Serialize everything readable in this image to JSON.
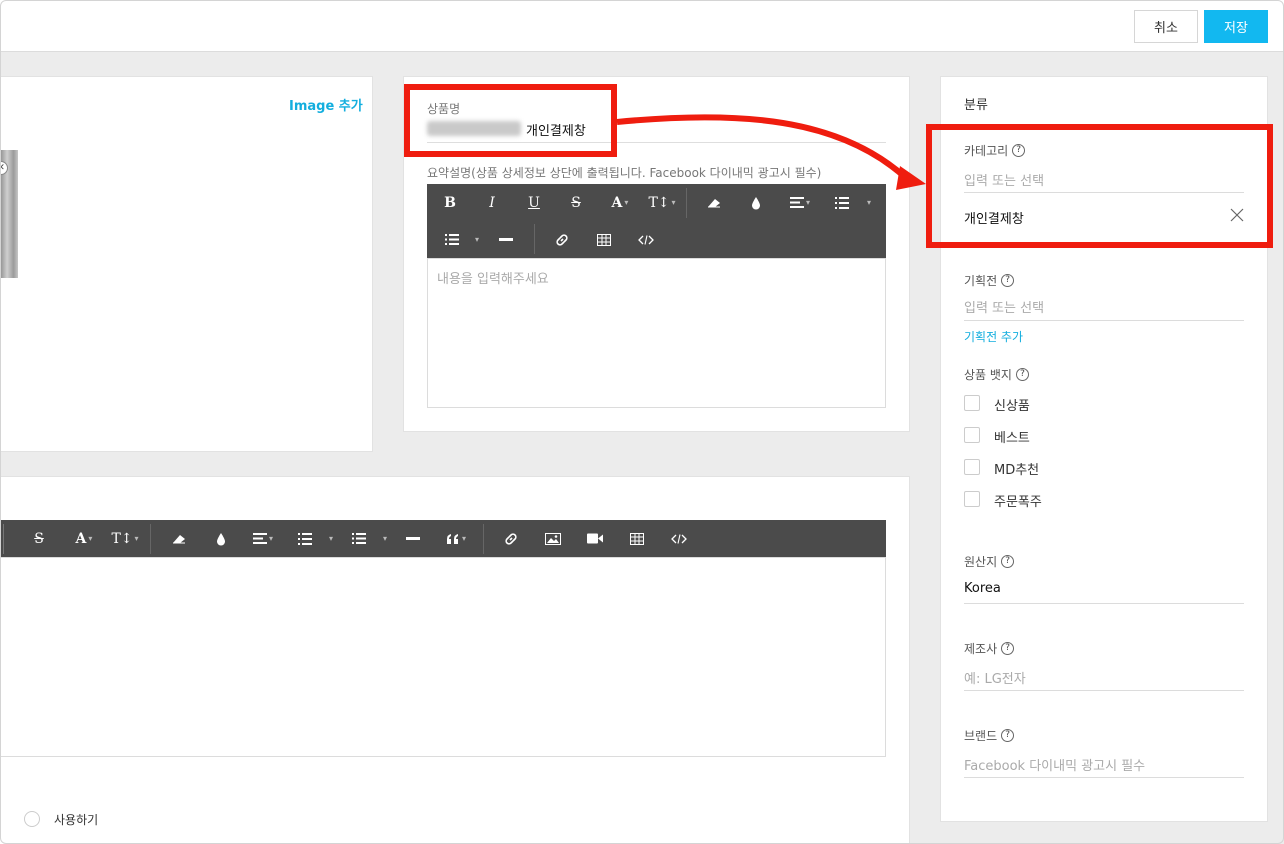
{
  "toolbar": {
    "cancel_label": "취소",
    "save_label": "저장"
  },
  "image_panel": {
    "add_label": "Image 추가",
    "thumb_close": "✕"
  },
  "product": {
    "name_label": "상품명",
    "name_value": "개인결제창",
    "summary_label": "요약설명(상품 상세정보 상단에 출력됩니다. Facebook 다이내믹 광고시 필수)",
    "summary_placeholder": "내용을 입력해주세요"
  },
  "editor_toolbar": {
    "bold": "B",
    "italic": "I",
    "underline": "U",
    "strike": "S",
    "font_color": "A",
    "font_size": "T↕",
    "caret": "▾"
  },
  "description": {
    "use_label": "사용하기"
  },
  "sidebar": {
    "title": "분류",
    "help": "?",
    "category": {
      "label": "카테고리",
      "placeholder": "입력 또는 선택",
      "selected": "개인결제창"
    },
    "exhibition": {
      "label": "기획전",
      "placeholder": "입력 또는 선택",
      "add_link": "기획전 추가"
    },
    "badge": {
      "label": "상품 뱃지",
      "options": [
        "신상품",
        "베스트",
        "MD추천",
        "주문폭주"
      ]
    },
    "origin": {
      "label": "원산지",
      "value": "Korea"
    },
    "maker": {
      "label": "제조사",
      "placeholder": "예: LG전자"
    },
    "brand": {
      "label": "브랜드",
      "placeholder": "Facebook 다이내믹 광고시 필수"
    }
  },
  "colors": {
    "accent": "#12b8f0",
    "highlight": "#ef1d0f",
    "toolbar_bg": "#4b4b4b"
  }
}
